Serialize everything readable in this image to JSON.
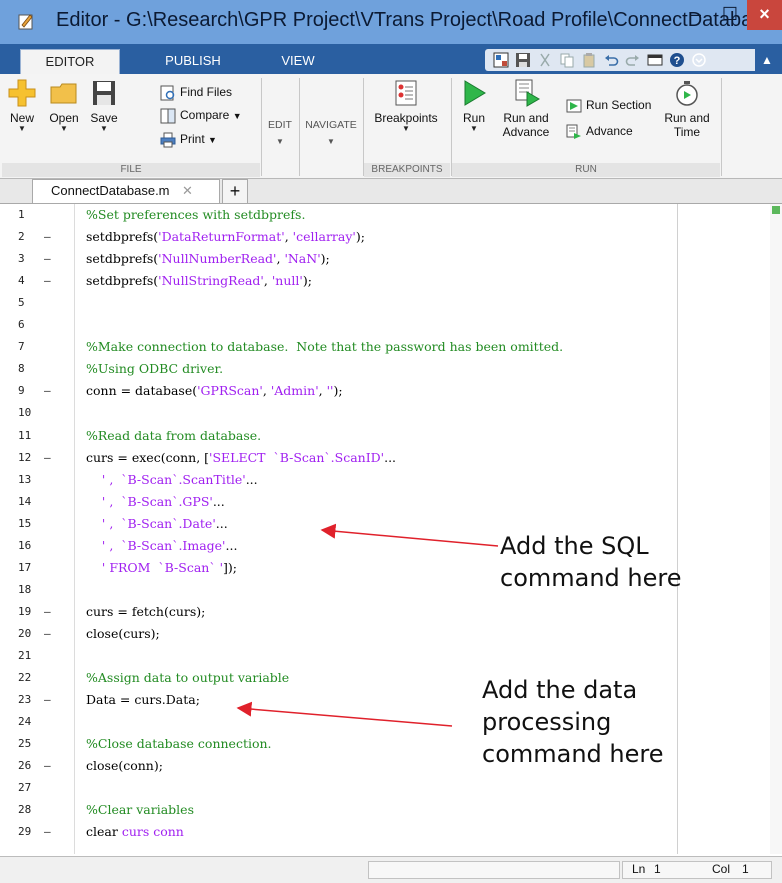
{
  "window": {
    "title": "Editor - G:\\Research\\GPR Project\\VTrans Project\\Road Profile\\ConnectDatabase.m",
    "controls": {
      "minimize": "–",
      "maximize": "☐",
      "close": "×"
    }
  },
  "ribbon": {
    "tabs": [
      {
        "label": "EDITOR",
        "active": true
      },
      {
        "label": "PUBLISH",
        "active": false
      },
      {
        "label": "VIEW",
        "active": false
      }
    ],
    "groups": {
      "file": {
        "title": "FILE",
        "new": "New",
        "open": "Open",
        "save": "Save",
        "find_files": "Find Files",
        "compare": "Compare",
        "print": "Print"
      },
      "edit": {
        "title": "EDIT"
      },
      "navigate": {
        "title": "NAVIGATE"
      },
      "breakpoints": {
        "title": "BREAKPOINTS",
        "button": "Breakpoints"
      },
      "run": {
        "title": "RUN",
        "run": "Run",
        "run_and_advance_1": "Run and",
        "run_and_advance_2": "Advance",
        "run_section": "Run Section",
        "advance": "Advance",
        "run_and_time_1": "Run and",
        "run_and_time_2": "Time"
      }
    }
  },
  "document_tab": {
    "name": "ConnectDatabase.m",
    "close": "✕",
    "new": "+"
  },
  "code_lines": [
    {
      "n": "1",
      "dash": "",
      "text": "%Set preferences with setdbprefs."
    },
    {
      "n": "2",
      "dash": "–",
      "text": "setdbprefs('DataReturnFormat', 'cellarray');"
    },
    {
      "n": "3",
      "dash": "–",
      "text": "setdbprefs('NullNumberRead', 'NaN');"
    },
    {
      "n": "4",
      "dash": "–",
      "text": "setdbprefs('NullStringRead', 'null');"
    },
    {
      "n": "5",
      "dash": "",
      "text": ""
    },
    {
      "n": "6",
      "dash": "",
      "text": ""
    },
    {
      "n": "7",
      "dash": "",
      "text": "%Make connection to database.  Note that the password has been omitted."
    },
    {
      "n": "8",
      "dash": "",
      "text": "%Using ODBC driver."
    },
    {
      "n": "9",
      "dash": "–",
      "text": "conn = database('GPRScan', 'Admin', '');"
    },
    {
      "n": "10",
      "dash": "",
      "text": ""
    },
    {
      "n": "11",
      "dash": "",
      "text": "%Read data from database."
    },
    {
      "n": "12",
      "dash": "–",
      "text": "curs = exec(conn, ['SELECT  `B-Scan`.ScanID'..."
    },
    {
      "n": "13",
      "dash": "",
      "text": "    ' ,  `B-Scan`.ScanTitle'..."
    },
    {
      "n": "14",
      "dash": "",
      "text": "    ' ,  `B-Scan`.GPS'..."
    },
    {
      "n": "15",
      "dash": "",
      "text": "    ' ,  `B-Scan`.Date'..."
    },
    {
      "n": "16",
      "dash": "",
      "text": "    ' ,  `B-Scan`.Image'..."
    },
    {
      "n": "17",
      "dash": "",
      "text": "    ' FROM  `B-Scan` ']);"
    },
    {
      "n": "18",
      "dash": "",
      "text": ""
    },
    {
      "n": "19",
      "dash": "–",
      "text": "curs = fetch(curs);"
    },
    {
      "n": "20",
      "dash": "–",
      "text": "close(curs);"
    },
    {
      "n": "21",
      "dash": "",
      "text": ""
    },
    {
      "n": "22",
      "dash": "",
      "text": "%Assign data to output variable"
    },
    {
      "n": "23",
      "dash": "–",
      "text": "Data = curs.Data;"
    },
    {
      "n": "24",
      "dash": "",
      "text": ""
    },
    {
      "n": "25",
      "dash": "",
      "text": "%Close database connection."
    },
    {
      "n": "26",
      "dash": "–",
      "text": "close(conn);"
    },
    {
      "n": "27",
      "dash": "",
      "text": ""
    },
    {
      "n": "28",
      "dash": "",
      "text": "%Clear variables"
    },
    {
      "n": "29",
      "dash": "–",
      "text": "clear curs conn"
    }
  ],
  "annotations": {
    "sql": [
      "Add the SQL",
      "command here"
    ],
    "data": [
      "Add the data",
      "processing",
      "command here"
    ]
  },
  "statusbar": {
    "ln_label": "Ln",
    "ln_value": "1",
    "col_label": "Col",
    "col_value": "1"
  },
  "colors": {
    "title_bar": "#6fa1dc",
    "tab_strip": "#2a5fa1",
    "string": "#a020f0",
    "comment": "#228b22",
    "keyword": "#0000ff",
    "arrow": "#e0212b"
  }
}
